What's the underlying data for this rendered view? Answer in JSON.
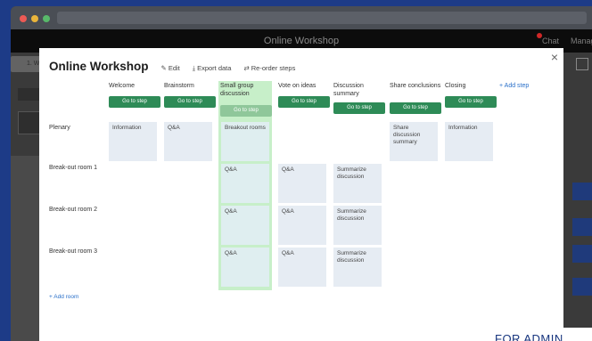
{
  "window": {
    "app_title": "Online Workshop",
    "chat_label": "Chat",
    "chat_badge": "1",
    "manage_label": "Manage",
    "bg_step_label": "1. W"
  },
  "modal": {
    "title": "Online Workshop",
    "edit_label": "Edit",
    "export_label": "Export data",
    "reorder_label": "Re-order steps",
    "close_label": "×",
    "add_step_label": "+ Add step",
    "add_room_label": "+ Add room",
    "go_label": "Go to step",
    "steps": [
      {
        "name": "Welcome"
      },
      {
        "name": "Brainstorm"
      },
      {
        "name": "Small group discussion"
      },
      {
        "name": "Vote on ideas"
      },
      {
        "name": "Discussion summary"
      },
      {
        "name": "Share conclusions"
      },
      {
        "name": "Closing"
      }
    ],
    "rooms": [
      {
        "name": "Plenary",
        "cells": [
          "Information",
          "Q&A",
          "Breakout rooms",
          "",
          "",
          "Share discussion summary",
          "Information"
        ]
      },
      {
        "name": "Break-out room 1",
        "cells": [
          "",
          "",
          "Q&A",
          "Q&A",
          "Summarize discussion",
          "",
          ""
        ]
      },
      {
        "name": "Break-out room 2",
        "cells": [
          "",
          "",
          "Q&A",
          "Q&A",
          "Summarize discussion",
          "",
          ""
        ]
      },
      {
        "name": "Break-out room 3",
        "cells": [
          "",
          "",
          "Q&A",
          "Q&A",
          "Summarize discussion",
          "",
          ""
        ]
      }
    ]
  },
  "footer_badge": "FOR ADMIN"
}
